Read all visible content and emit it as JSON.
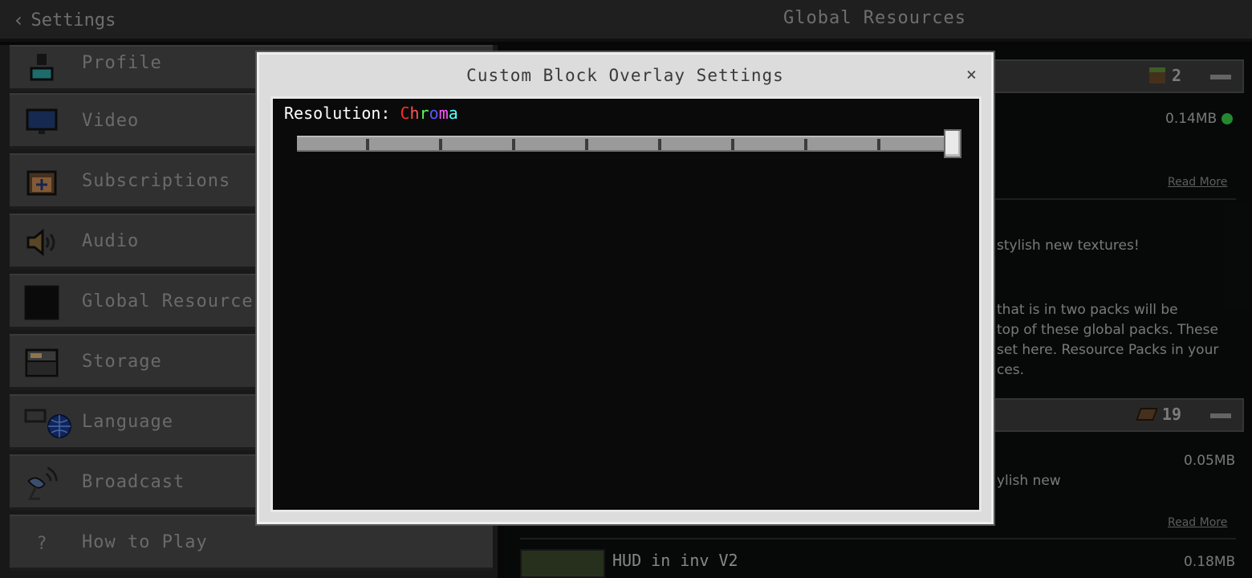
{
  "header": {
    "back_label": "Settings",
    "title": "Global Resources"
  },
  "sidebar": {
    "items": [
      {
        "label": "Profile"
      },
      {
        "label": "Video"
      },
      {
        "label": "Subscriptions"
      },
      {
        "label": "Audio"
      },
      {
        "label": "Global Resources"
      },
      {
        "label": "Storage"
      },
      {
        "label": "Language"
      },
      {
        "label": "Broadcast"
      },
      {
        "label": "How to Play",
        "icon_text": "?"
      }
    ]
  },
  "right": {
    "pack1": {
      "count": "2",
      "size": "0.14MB"
    },
    "pack2": {
      "count": "19",
      "size": "0.05MB"
    },
    "pack3": {
      "title": "HUD in inv V2",
      "size": "0.18MB"
    },
    "read_more": "Read More",
    "desc_line1": "stylish new textures!",
    "desc_line2": "that is in two packs will be",
    "desc_line3": "top of these global packs. These",
    "desc_line4": "set here. Resource Packs in your",
    "desc_line5": "ces.",
    "desc_line6": "ylish new"
  },
  "modal": {
    "title": "Custom Block Overlay Settings",
    "close": "×",
    "resolution_label": "Resolution:",
    "resolution_value": [
      "C",
      "h",
      "r",
      "o",
      "m",
      "a"
    ],
    "resolution_colors": [
      "#ff2a2a",
      "#ff5555",
      "#55ff55",
      "#5555ff",
      "#ff55ff",
      "#55ffff"
    ],
    "slider_level": 1.0
  },
  "colors": {
    "accent_green": "#3ad24a",
    "panel": "#4a4a4a"
  }
}
